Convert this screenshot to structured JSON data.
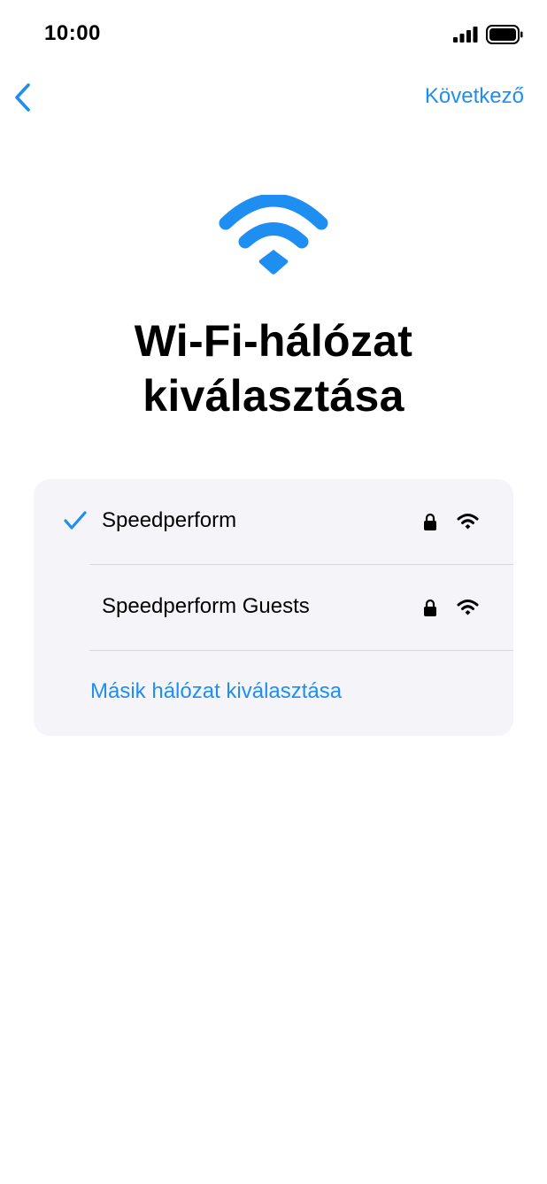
{
  "status_bar": {
    "time": "10:00",
    "icons": [
      "signal-bars-icon",
      "battery-icon"
    ]
  },
  "nav": {
    "back_icon": "chevron-left-icon",
    "next_label": "Következő"
  },
  "hero": {
    "icon": "wifi-icon",
    "title": "Wi-Fi-hálózat kiválasztása"
  },
  "networks": [
    {
      "name": "Speedperform",
      "selected": true,
      "secured": true,
      "icons": [
        "checkmark-icon",
        "lock-icon",
        "wifi-icon"
      ]
    },
    {
      "name": "Speedperform Guests",
      "selected": false,
      "secured": true,
      "icons": [
        "lock-icon",
        "wifi-icon"
      ]
    }
  ],
  "other_network_label": "Másik hálózat kiválasztása",
  "colors": {
    "accent": "#1f8ef1",
    "card_background": "#f5f5f9",
    "divider": "#d8d8dc",
    "text": "#000000",
    "background": "#ffffff"
  }
}
